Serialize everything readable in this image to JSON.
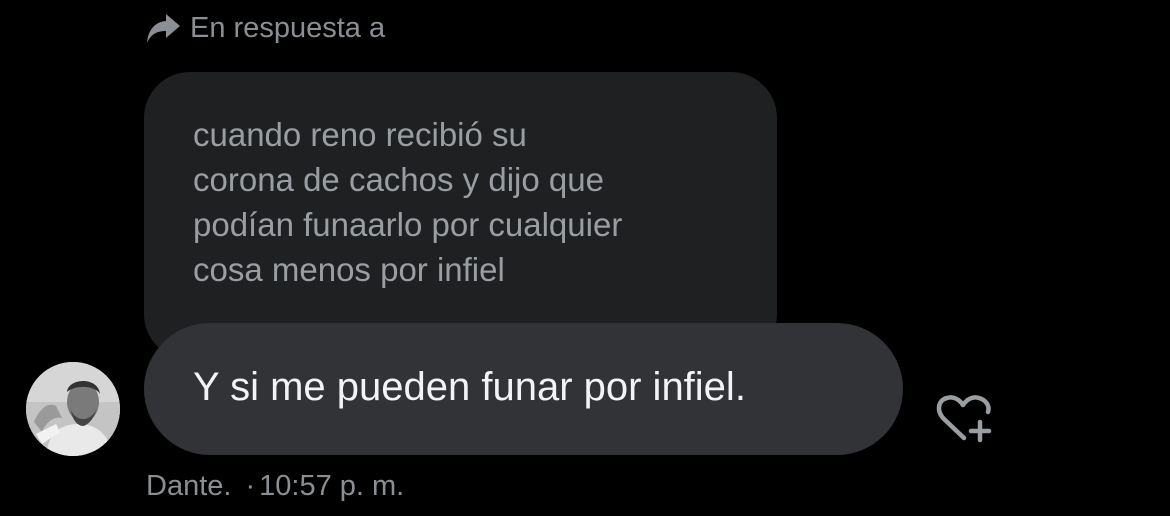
{
  "reply_header": {
    "icon": "reply-arrow-icon",
    "label": "En respuesta a"
  },
  "quoted_message": {
    "text": "cuando reno recibió su\ncorona de cachos y dijo que\npodían funaarlo por cualquier\ncosa menos por infiel"
  },
  "message": {
    "text": "Y si me pueden funar por infiel."
  },
  "sender": {
    "avatar_icon": "profile-photo",
    "name": "Dante.",
    "separator": "·",
    "time": "10:57 p. m."
  },
  "actions": {
    "react_icon": "heart-plus-icon"
  },
  "colors": {
    "background": "#000000",
    "quoted_bubble": "#1f2022",
    "message_bubble": "#323336",
    "secondary_text": "#8b8f94"
  }
}
